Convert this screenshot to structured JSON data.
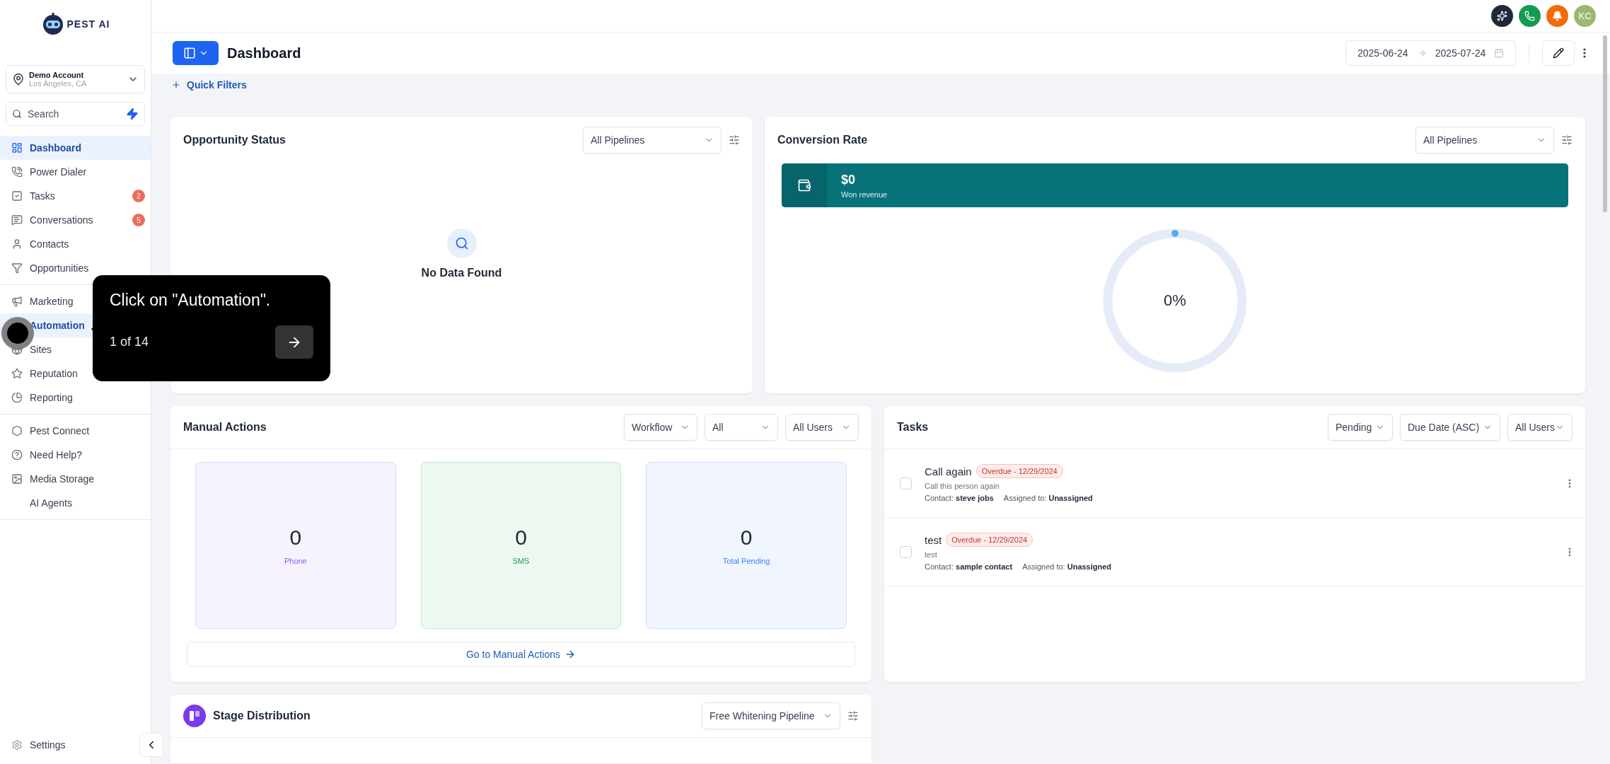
{
  "sidebar": {
    "brand": "PEST AI",
    "account": {
      "name": "Demo Account",
      "location": "Los Angeles, CA"
    },
    "search": {
      "placeholder": "Search"
    },
    "nav_groups": [
      [
        {
          "label": "Dashboard",
          "selected": true
        },
        {
          "label": "Power Dialer",
          "selected": false
        },
        {
          "label": "Tasks",
          "selected": false,
          "badge": "2"
        },
        {
          "label": "Conversations",
          "selected": false,
          "badge": "5"
        },
        {
          "label": "Contacts",
          "selected": false
        },
        {
          "label": "Opportunities",
          "selected": false
        }
      ],
      [
        {
          "label": "Marketing",
          "selected": false
        },
        {
          "label": "Automation",
          "selected": true
        },
        {
          "label": "Sites",
          "selected": false
        },
        {
          "label": "Reputation",
          "selected": false
        },
        {
          "label": "Reporting",
          "selected": false
        }
      ],
      [
        {
          "label": "Pest Connect",
          "selected": false
        },
        {
          "label": "Need Help?",
          "selected": false
        },
        {
          "label": "Media Storage",
          "selected": false
        },
        {
          "label": "AI Agents",
          "selected": false
        }
      ]
    ],
    "settings": "Settings"
  },
  "top_bar": {
    "avatar": "KC"
  },
  "header": {
    "title": "Dashboard",
    "date_from": "2025-06-24",
    "date_to": "2025-07-24",
    "quick_filters": "Quick Filters"
  },
  "opportunity_status": {
    "title": "Opportunity Status",
    "pipeline": "All Pipelines",
    "empty": "No Data Found"
  },
  "conversion_rate": {
    "title": "Conversion Rate",
    "pipeline": "All Pipelines",
    "revenue": "$0",
    "revenue_label": "Won revenue",
    "percent": "0%"
  },
  "manual_actions": {
    "title": "Manual Actions",
    "filters": [
      "Workflow",
      "All",
      "All Users"
    ],
    "stats": [
      {
        "value": "0",
        "label": "Phone",
        "color": "#8b5cf6"
      },
      {
        "value": "0",
        "label": "SMS",
        "color": "#16a34a"
      },
      {
        "value": "0",
        "label": "Total Pending",
        "color": "#3b82f6"
      }
    ],
    "link": "Go to Manual Actions"
  },
  "tasks": {
    "title": "Tasks",
    "filters": [
      "Pending",
      "Due Date (ASC)",
      "All Users"
    ],
    "rows": [
      {
        "title": "Call again",
        "badge": "Overdue - 12/29/2024",
        "description": "Call this person again",
        "contact": "Contact: **steve jobs**",
        "assigned": "Assigned to: **Unassigned**",
        "checked": false
      },
      {
        "title": "test",
        "badge": "Overdue - 12/29/2024",
        "description": "test",
        "contact": "Contact: **sample contact**",
        "assigned": "Assigned to: **Unassigned**",
        "checked": false
      }
    ]
  },
  "stage_distribution": {
    "title": "Stage Distribution",
    "pipeline": "Free Whitening Pipeline"
  },
  "tour": {
    "text": "Click on \"Automation\".",
    "step": "1 of 14"
  }
}
